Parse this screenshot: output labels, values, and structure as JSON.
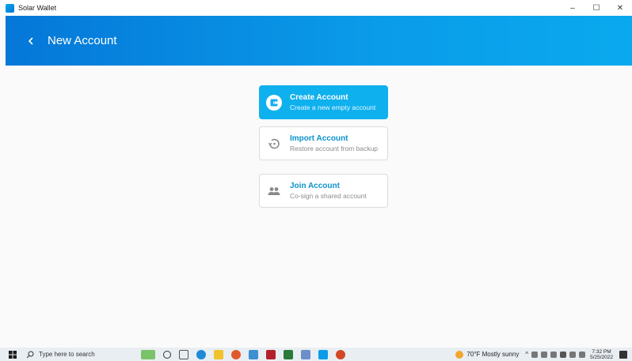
{
  "window": {
    "title": "Solar Wallet",
    "minimize_glyph": "–",
    "maximize_glyph": "☐",
    "close_glyph": "✕"
  },
  "header": {
    "back_icon": "chevron-left-icon",
    "title": "New Account"
  },
  "options": [
    {
      "icon": "wallet-icon",
      "title": "Create Account",
      "subtitle": "Create a new empty account",
      "primary": true
    },
    {
      "icon": "restore-icon",
      "title": "Import Account",
      "subtitle": "Restore account from backup",
      "primary": false
    },
    {
      "icon": "people-icon",
      "title": "Join Account",
      "subtitle": "Co-sign a shared account",
      "primary": false
    }
  ],
  "taskbar": {
    "search_placeholder": "Type here to search",
    "weather": "70°F  Mostly sunny",
    "time": "7:32 PM",
    "date": "5/25/2022"
  },
  "colors": {
    "header_start": "#0577d8",
    "header_end": "#0aa9ee",
    "primary_card": "#0fb0ee",
    "accent_text": "#0b93c9"
  }
}
